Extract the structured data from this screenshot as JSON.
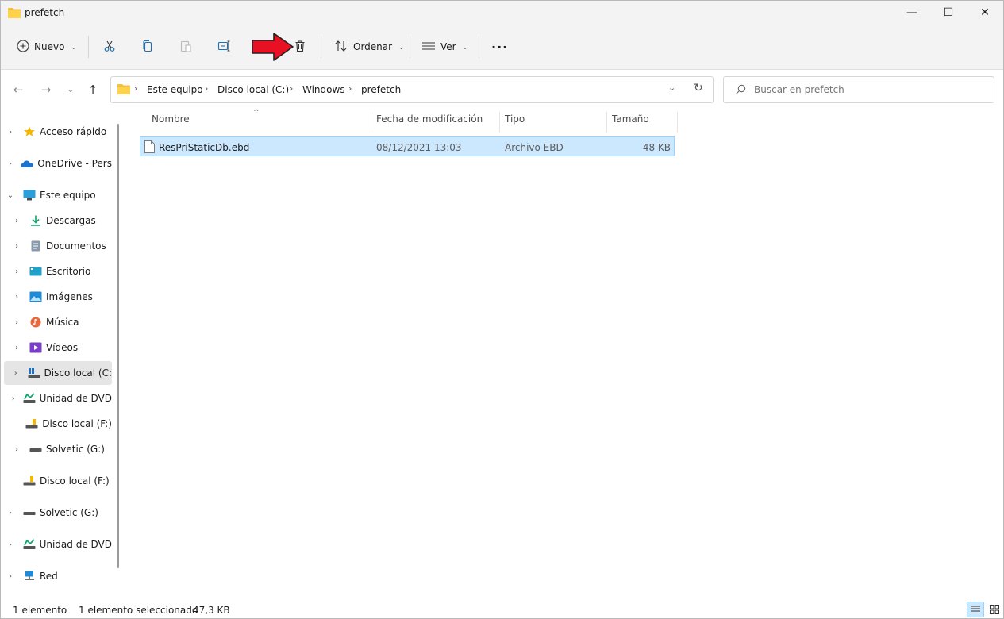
{
  "window": {
    "title": "prefetch",
    "controls": {
      "minimize": "—",
      "maximize": "☐",
      "close": "✕"
    }
  },
  "toolbar": {
    "new_label": "Nuevo",
    "sort_label": "Ordenar",
    "view_label": "Ver",
    "more_label": "···"
  },
  "address": {
    "crumbs": [
      "Este equipo",
      "Disco local (C:)",
      "Windows",
      "prefetch"
    ],
    "separator": "›"
  },
  "search": {
    "placeholder": "Buscar en prefetch"
  },
  "sidebar": {
    "items": [
      {
        "label": "Acceso rápido"
      },
      {
        "label": "OneDrive - Pers"
      },
      {
        "label": "Este equipo"
      },
      {
        "label": "Descargas"
      },
      {
        "label": "Documentos"
      },
      {
        "label": "Escritorio"
      },
      {
        "label": "Imágenes"
      },
      {
        "label": "Música"
      },
      {
        "label": "Vídeos"
      },
      {
        "label": "Disco local (C:"
      },
      {
        "label": "Unidad de DVD"
      },
      {
        "label": "Disco local (F:)"
      },
      {
        "label": "Solvetic (G:)"
      },
      {
        "label": "Disco local (F:)"
      },
      {
        "label": "Solvetic (G:)"
      },
      {
        "label": "Unidad de DVD"
      },
      {
        "label": "Red"
      }
    ]
  },
  "columns": {
    "name": "Nombre",
    "modified": "Fecha de modificación",
    "type": "Tipo",
    "size": "Tamaño"
  },
  "files": [
    {
      "name": "ResPriStaticDb.ebd",
      "modified": "08/12/2021 13:03",
      "type": "Archivo EBD",
      "size": "48 KB"
    }
  ],
  "status": {
    "count": "1 elemento",
    "selected": "1 elemento seleccionado",
    "selected_size": "47,3 KB"
  },
  "colors": {
    "accent": "#0067c0",
    "selection": "#cce8ff",
    "arrow": "#e81123"
  }
}
